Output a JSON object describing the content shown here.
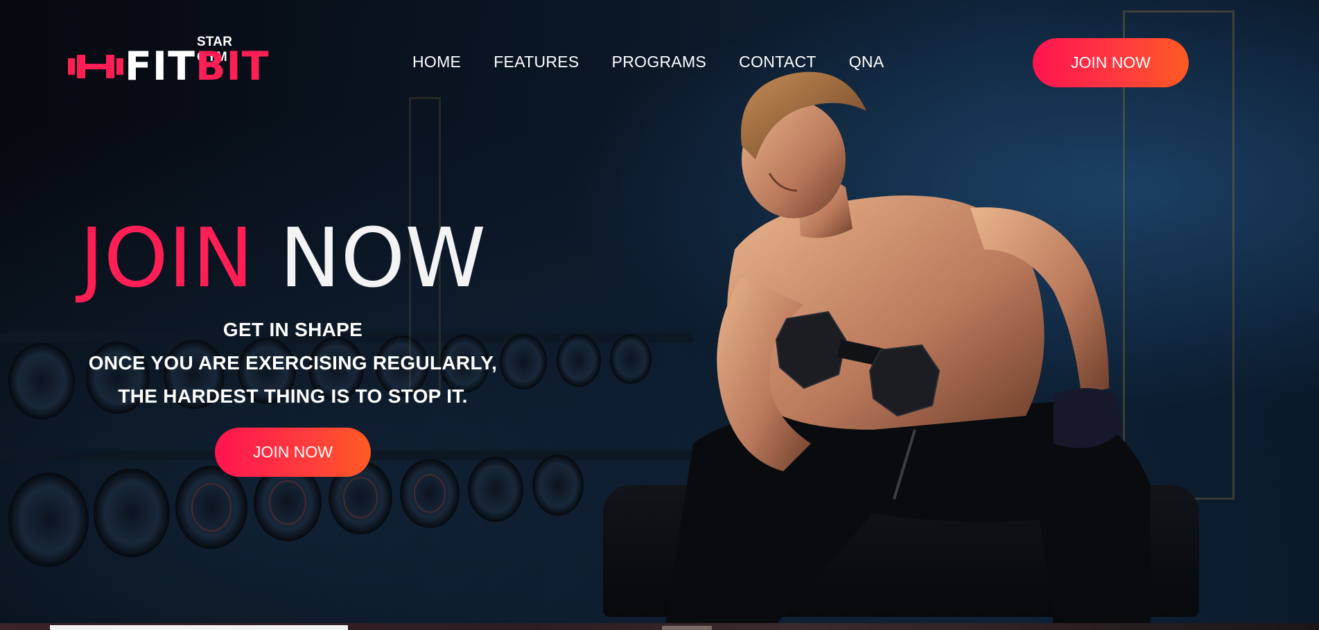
{
  "brand": {
    "subtitle": "STAR GYM",
    "name_part1": "FIT",
    "name_part2": "BIT",
    "icon": "dumbbell-icon",
    "accent_color": "#ff1f55"
  },
  "nav": {
    "items": [
      {
        "label": "HOME"
      },
      {
        "label": "FEATURES"
      },
      {
        "label": "PROGRAMS"
      },
      {
        "label": "CONTACT"
      },
      {
        "label": "QNA"
      }
    ]
  },
  "header": {
    "cta_label": "JOIN NOW"
  },
  "hero": {
    "headline_part1": "JOIN",
    "headline_part2": "NOW",
    "tagline": [
      "GET IN SHAPE",
      "ONCE YOU ARE EXERCISING REGULARLY,",
      "THE HARDEST THING IS TO STOP IT."
    ],
    "cta_label": "JOIN NOW",
    "button_gradient": [
      "#ff1450",
      "#ff5a23"
    ]
  }
}
